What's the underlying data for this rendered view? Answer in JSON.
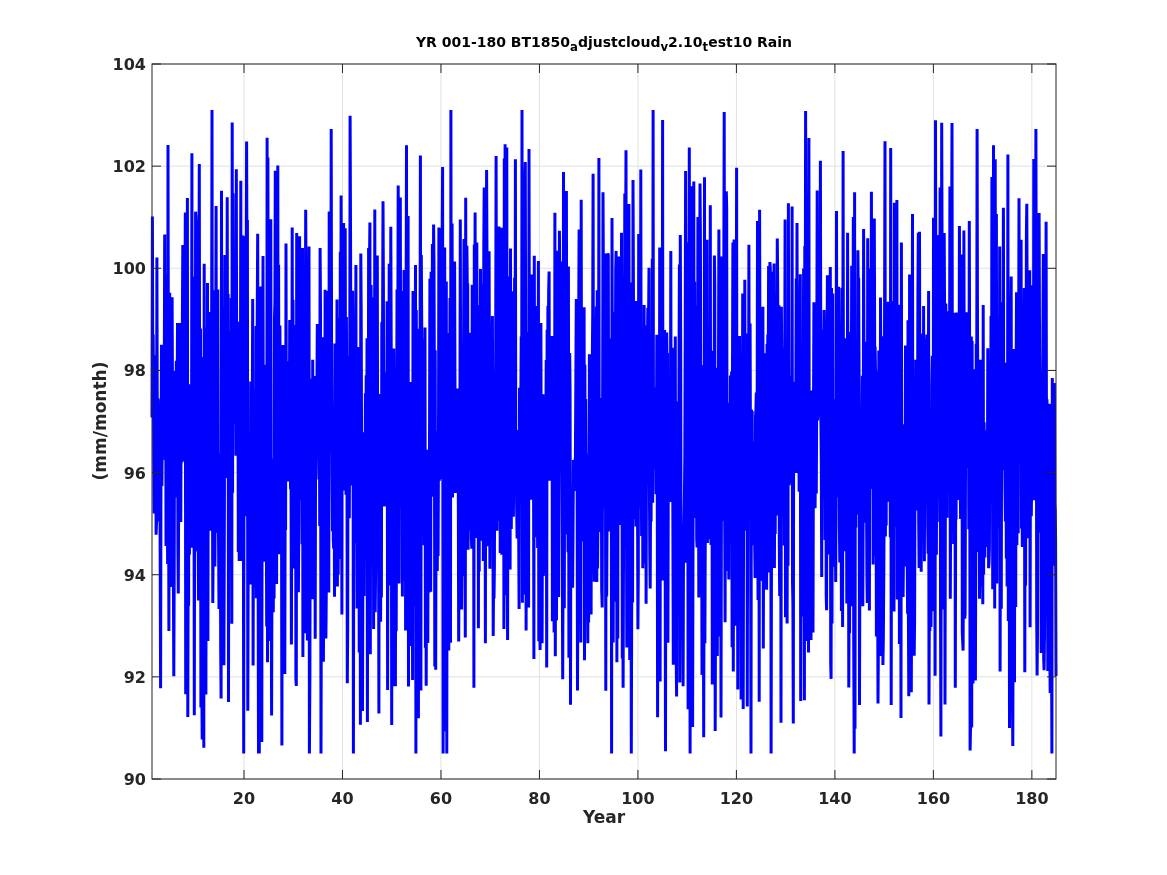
{
  "figure": {
    "title": "YR 001-180 BT1850$_{a}$djustcloud$_{v}$2.10$_{t}$est10 Rain",
    "y_axis": {
      "label": "(mm/month)",
      "ticks": [
        "104",
        "102",
        "100",
        "98",
        "96",
        "94",
        "92",
        "90"
      ]
    },
    "x_axis": {
      "label": "Year",
      "ticks": [
        "20",
        "40",
        "60",
        "80",
        "100",
        "120",
        "140",
        "160",
        "180"
      ]
    }
  }
}
